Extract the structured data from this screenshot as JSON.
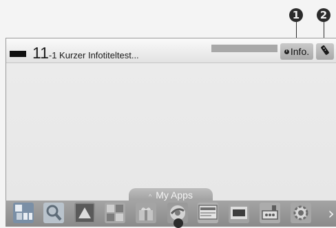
{
  "callouts": [
    "1",
    "2"
  ],
  "info_bar": {
    "channel_number": "11",
    "programme_title": "-1 Kurzer Infotiteltest...",
    "info_button_label": "Info.",
    "info_dot_glyph": "i",
    "remote_icon": "remote-control-icon"
  },
  "apps_bar": {
    "tab_label": "My Apps",
    "tab_arrow": "^",
    "next_glyph": "›",
    "icons": [
      "numeric-keypad-icon",
      "search-icon",
      "app-logo-icon",
      "media-player-icon",
      "gift-icon",
      "web-browser-icon",
      "tv-guide-icon",
      "3d-icon",
      "device-connections-icon",
      "settings-gear-icon"
    ]
  }
}
